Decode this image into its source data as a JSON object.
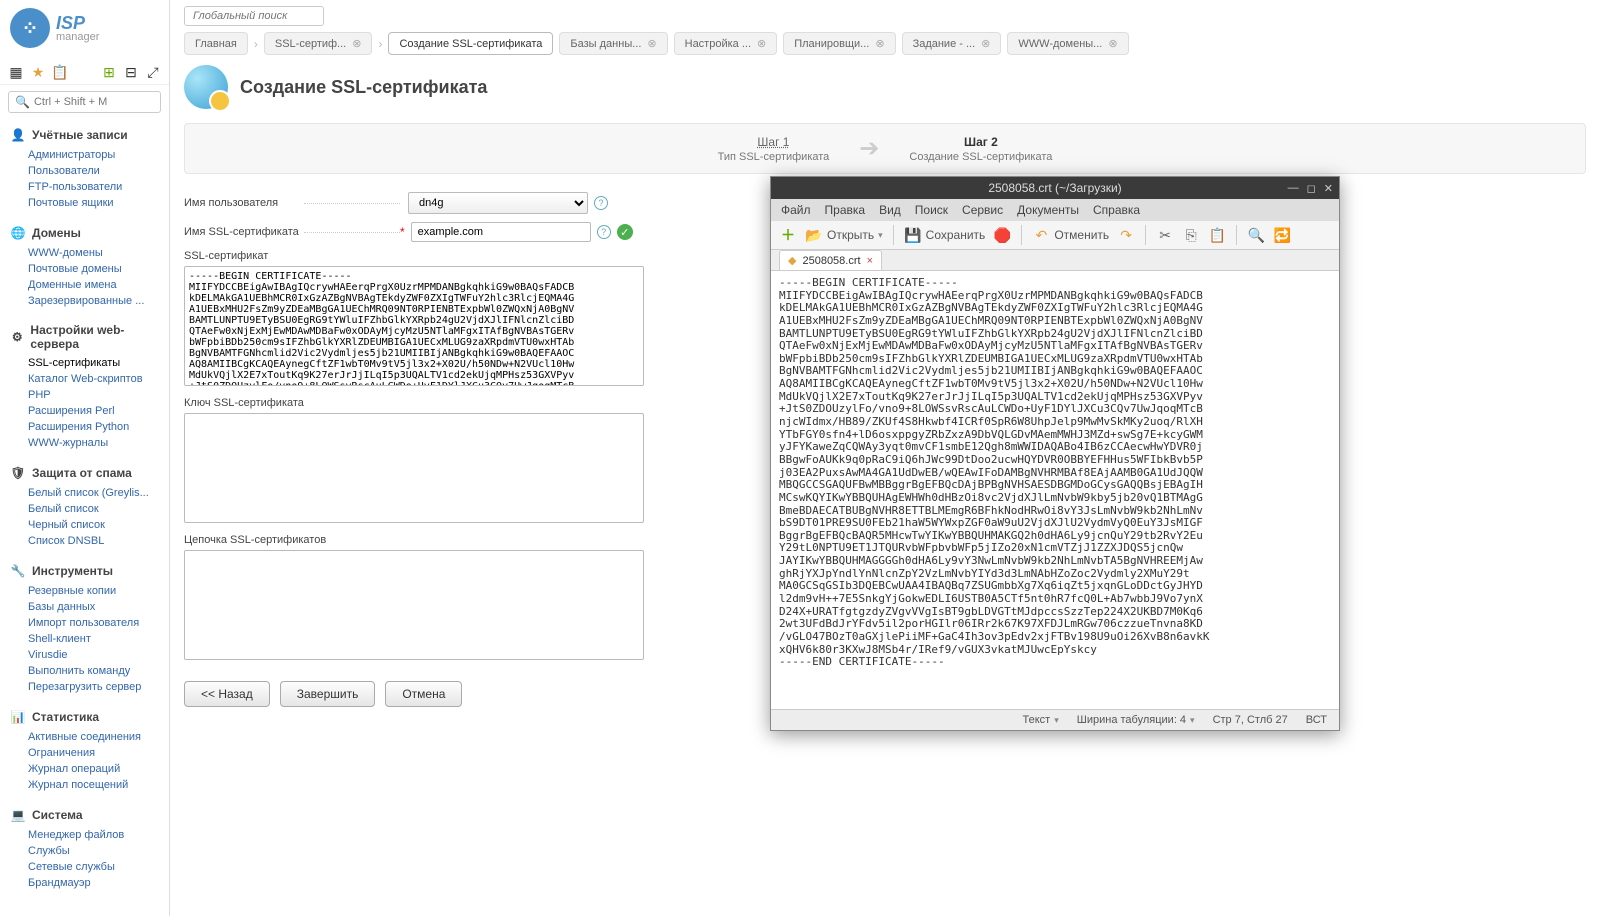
{
  "logo": {
    "isp": "ISP",
    "mgr": "manager"
  },
  "search_placeholder": "Ctrl + Shift + M",
  "global_search_placeholder": "Глобальный поиск",
  "nav": [
    {
      "title": "Учётные записи",
      "icon": "👤",
      "items": [
        "Администраторы",
        "Пользователи",
        "FTP-пользователи",
        "Почтовые ящики"
      ]
    },
    {
      "title": "Домены",
      "icon": "🌐",
      "items": [
        "WWW-домены",
        "Почтовые домены",
        "Доменные имена",
        "Зарезервированные ..."
      ]
    },
    {
      "title": "Настройки web-сервера",
      "icon": "⚙",
      "items": [
        "SSL-сертификаты",
        "Каталог Web-скриптов",
        "PHP",
        "Расширения Perl",
        "Расширения Python",
        "WWW-журналы"
      ],
      "active_index": 0
    },
    {
      "title": "Защита от спама",
      "icon": "🛡",
      "items": [
        "Белый список (Greylis...",
        "Белый список",
        "Черный список",
        "Список DNSBL"
      ]
    },
    {
      "title": "Инструменты",
      "icon": "🔧",
      "items": [
        "Резервные копии",
        "Базы данных",
        "Импорт пользователя",
        "Shell-клиент",
        "Virusdie",
        "Выполнить команду",
        "Перезагрузить сервер"
      ]
    },
    {
      "title": "Статистика",
      "icon": "📊",
      "items": [
        "Активные соединения",
        "Ограничения",
        "Журнал операций",
        "Журнал посещений"
      ]
    },
    {
      "title": "Система",
      "icon": "💻",
      "items": [
        "Менеджер файлов",
        "Службы",
        "Сетевые службы",
        "Брандмауэр"
      ]
    }
  ],
  "tabs": [
    "Главная",
    "SSL-сертиф... ⊗",
    "Создание SSL-сертификата",
    "Базы данны... ⊗",
    "Настройка ... ⊗",
    "Планировщи... ⊗",
    "Задание - ... ⊗",
    "WWW-домены... ⊗"
  ],
  "active_tab": 2,
  "page_title": "Создание SSL-сертификата",
  "steps": {
    "s1_title": "Шаг 1",
    "s1_sub": "Тип SSL-сертификата",
    "s2_title": "Шаг 2",
    "s2_sub": "Создание SSL-сертификата"
  },
  "form": {
    "user_label": "Имя пользователя",
    "user_value": "dn4g",
    "name_label": "Имя SSL-сертификата",
    "name_value": "example.com",
    "cert_label": "SSL-сертификат",
    "cert_value": "-----BEGIN CERTIFICATE-----\nMIIFYDCCBEigAwIBAgIQcrywHAEerqPrgX0UzrMPMDANBgkqhkiG9w0BAQsFADCB\nkDELMAkGA1UEBhMCR0IxGzAZBgNVBAgTEkdyZWF0ZXIgTWFuY2hlc3RlcjEQMA4G\nA1UEBxMHU2FsZm9yZDEaMBgGA1UEChMRQ09NT0RPIENBTExpbWl0ZWQxNjA0BgNV\nBAMTLUNPTU9ETyBSU0EgRG9tYWluIFZhbGlkYXRpb24gU2VjdXJlIFNlcnZlciBD\nQTAeFw0xNjExMjEwMDAwMDBaFw0xODAyMjcyMzU5NTlaMFgxITAfBgNVBAsTGERv\nbWFpbiBDb250cm9sIFZhbGlkYXRlZDEUMBIGA1UECxMLUG9zaXRpdmVTU0wxHTAb\nBgNVBAMTFGNhcmlid2Vic2Vydmljes5jb21UMIIBIjANBgkqhkiG9w0BAQEFAAOC\nAQ8AMIIBCgKCAQEAynegCftZF1wbT0Mv9tV5jl3x2+X02U/h50NDw+N2VUcl10Hw\nMdUkVQjlX2E7xToutKq9K27erJrJjILqI5p3UQALTV1cd2ekUjqMPHsz53GXVPyv\n+JtS0ZDOUzylFo/vno9+8LOWSsvRscAuLCWDo+UyF1DYlJXCu3CQv7UwJqoqMTcB",
    "key_label": "Ключ SSL-сертификата",
    "chain_label": "Цепочка SSL-сертификатов"
  },
  "buttons": {
    "back": "<< Назад",
    "finish": "Завершить",
    "cancel": "Отмена"
  },
  "editor": {
    "title": "2508058.crt (~/Загрузки)",
    "menu": [
      "Файл",
      "Правка",
      "Вид",
      "Поиск",
      "Сервис",
      "Документы",
      "Справка"
    ],
    "open": "Открыть",
    "save": "Сохранить",
    "undo": "Отменить",
    "tab_name": "2508058.crt",
    "body": "-----BEGIN CERTIFICATE-----\nMIIFYDCCBEigAwIBAgIQcrywHAEerqPrgX0UzrMPMDANBgkqhkiG9w0BAQsFADCB\nkDELMAkGA1UEBhMCR0IxGzAZBgNVBAgTEkdyZWF0ZXIgTWFuY2hlc3RlcjEQMA4G\nA1UEBxMHU2FsZm9yZDEaMBgGA1UEChMRQ09NT0RPIENBTExpbWl0ZWQxNjA0BgNV\nBAMTLUNPTU9ETyBSU0EgRG9tYWluIFZhbGlkYXRpb24gU2VjdXJlIFNlcnZlciBD\nQTAeFw0xNjExMjEwMDAwMDBaFw0xODAyMjcyMzU5NTlaMFgxITAfBgNVBAsTGERv\nbWFpbiBDb250cm9sIFZhbGlkYXRlZDEUMBIGA1UECxMLUG9zaXRpdmVTU0wxHTAb\nBgNVBAMTFGNhcmlid2Vic2Vydmljes5jb21UMIIBIjANBgkqhkiG9w0BAQEFAAOC\nAQ8AMIIBCgKCAQEAynegCftZF1wbT0Mv9tV5jl3x2+X02U/h50NDw+N2VUcl10Hw\nMdUkVQjlX2E7xToutKq9K27erJrJjILqI5p3UQALTV1cd2ekUjqMPHsz53GXVPyv\n+JtS0ZDOUzylFo/vno9+8LOWSsvRscAuLCWDo+UyF1DYlJXCu3CQv7UwJqoqMTcB\nnjcWIdmx/HB89/ZKUf4S8Hkwbf4ICRf0SpR6W8UhpJelp9MwMvSkMKy2uoq/RlXH\nYTbFGY0sfn4+lD6osxppgyZRbZxzA9DbVQLGDvMAemMWHJ3MZd+swSg7E+kcyGWM\nyJFYKaweZqCQWAy3yqt0mvCF1smbE12Qgh8mWWIDAQABo4IB6zCCAecwHwYDVR0j\nBBgwFoAUKk9q0pRaC9iQ6hJWc99DtDoo2ucwHQYDVR0OBBYEFHHus5WFIbkBvb5P\nj03EA2PuxsAwMA4GA1UdDwEB/wQEAwIFoDAMBgNVHRMBAf8EAjAAMB0GA1UdJQQW\nMBQGCCSGAQUFBwMBBggrBgEFBQcDAjBPBgNVHSAESDBGMDoGCysGAQQBsjEBAgIH\nMCswKQYIKwYBBQUHAgEWHWh0dHBzOi8vc2VjdXJlLmNvbW9kby5jb20vQ1BTMAgG\nBmeBDAECATBUBgNVHR8ETTBLMEmgR6BFhkNodHRwOi8vY3JsLmNvbW9kb2NhLmNv\nbS9DT01PRE9SU0FEb21haW5WYWxpZGF0aW9uU2VjdXJlU2VydmVyQ0EuY3JsMIGF\nBggrBgEFBQcBAQR5MHcwTwYIKwYBBQUHMAKGQ2h0dHA6Ly9jcnQuY29tb2RvY2Eu\nY29tL0NPTU9ET1JTQURvbWFpbvbWFp5jIZo20xN1cmVTZjJ1ZZXJDQS5jcnQw\nJAYIKwYBBQUHMAGGGGh0dHA6Ly9vY3NwLmNvbW9kb2NhLmNvbTA5BgNVHREEMjAw\nghRjYXJpYndlYnNlcnZpY2VzLmNvbYIYd3d3LmNAbHZoZoc2Vydmly2XMuY29t\nMA0GCSqGSIb3DQEBCwUAA4IBAQBq7ZSUGmbbXg7Xq6iqZt5jxqnGLoDDctGyJHYD\nl2dm9vH++7E5SnkgYjGokwEDLI6USTB0A5CTf5nt0hR7fcQ0L+Ab7wbbJ9Vo7ynX\nD24X+URATfgtgzdyZVgvVVgIsBT9gbLDVGTtMJdpccsSzzTep224X2UKBD7M0Kq6\n2wt3UFdBdJrYFdv5il2porHGIlr06IRr2k67K97XFDJLmRGw706czzueТnvna8KD\n/vGLO47BOzT0aGXjlePiiMF+GaC4Ih3ov3pEdv2xjFTBv198U9uOi26XvB8n6avkK\nxQHV6k80r3KXwJ8MSb4r/IRef9/vGUX3vkatMJUwcEpYskcy\n-----END CERTIFICATE-----",
    "status_text": "Текст",
    "status_tab": "Ширина табуляции: 4",
    "status_pos": "Стр 7, Стлб 27",
    "status_ins": "ВСТ"
  }
}
